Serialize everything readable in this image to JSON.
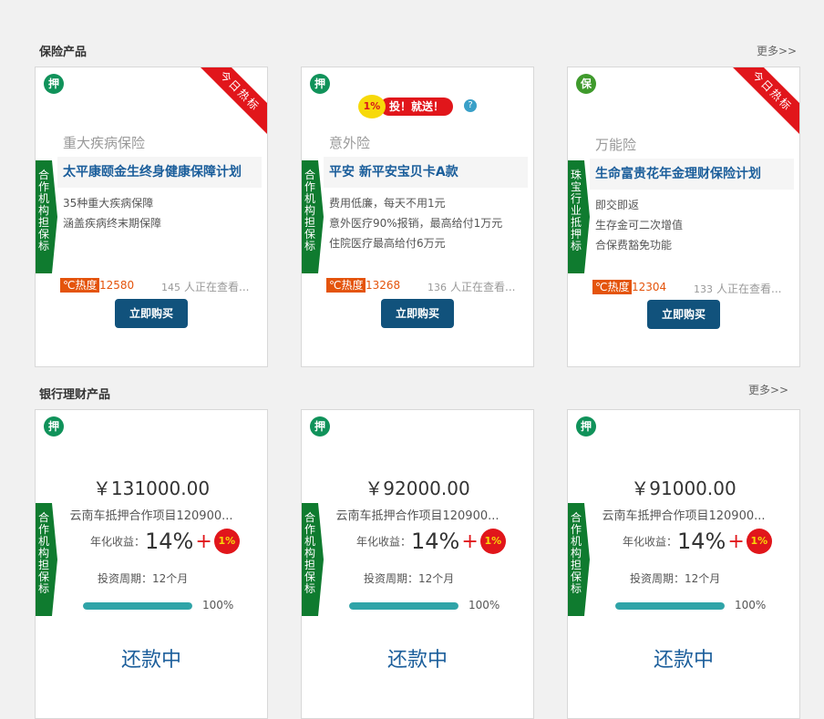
{
  "sections": {
    "insurance": {
      "title": "保险产品",
      "more": "更多>>"
    },
    "bank": {
      "title": "银行理财产品",
      "more": "更多>>"
    }
  },
  "colors": {
    "accent": "#11527c",
    "green_tag": "#0f7b2f",
    "hot_ribbon": "#e1161b",
    "heat": "#e4540c",
    "progress": "#2fa4a8",
    "status": "#1b5e9b"
  },
  "insurance_cards": [
    {
      "badge": "押",
      "ribbon": "今日热标",
      "side_tag": "合作机构担保标",
      "category": "重大疾病保险",
      "name": "太平康颐金生终身健康保障计划",
      "features": [
        "35种重大疾病保障",
        "涵盖疾病终末期保障"
      ],
      "heat_label": "℃热度",
      "heat": "12580",
      "viewers_count": "145",
      "viewers_text": "人正在查看...",
      "button": "立即购买"
    },
    {
      "badge": "押",
      "promo_pct": "1%",
      "promo_text": "投！就送！",
      "promo_help": "?",
      "side_tag": "合作机构担保标",
      "category": "意外险",
      "name": "平安  新平安宝贝卡A款",
      "features": [
        "费用低廉，每天不用1元",
        "意外医疗90%报销，最高给付1万元",
        "住院医疗最高给付6万元"
      ],
      "heat_label": "℃热度",
      "heat": "13268",
      "viewers_count": "136",
      "viewers_text": "人正在查看...",
      "button": "立即购买"
    },
    {
      "badge": "保",
      "ribbon": "今日热标",
      "side_tag": "珠宝行业抵押标",
      "category": "万能险",
      "name": "生命富贵花年金理财保险计划",
      "features": [
        "即交即返",
        "生存金可二次增值",
        "合保费豁免功能"
      ],
      "heat_label": "℃热度",
      "heat": "12304",
      "viewers_count": "133",
      "viewers_text": "人正在查看...",
      "button": "立即购买"
    }
  ],
  "bank_cards": [
    {
      "badge": "押",
      "side_tag": "合作机构担保标",
      "price": "￥131000.00",
      "project": "云南车抵押合作项目120900...",
      "yield_label": "年化收益：",
      "yield": "14%",
      "plus": "+",
      "bonus": "1%",
      "period": "投资周期：12个月",
      "progress": 1.0,
      "progress_label": "100%",
      "status": "还款中"
    },
    {
      "badge": "押",
      "side_tag": "合作机构担保标",
      "price": "￥92000.00",
      "project": "云南车抵押合作项目120900...",
      "yield_label": "年化收益：",
      "yield": "14%",
      "plus": "+",
      "bonus": "1%",
      "period": "投资周期：12个月",
      "progress": 1.0,
      "progress_label": "100%",
      "status": "还款中"
    },
    {
      "badge": "押",
      "side_tag": "合作机构担保标",
      "price": "￥91000.00",
      "project": "云南车抵押合作项目120900...",
      "yield_label": "年化收益：",
      "yield": "14%",
      "plus": "+",
      "bonus": "1%",
      "period": "投资周期：12个月",
      "progress": 1.0,
      "progress_label": "100%",
      "status": "还款中"
    }
  ]
}
